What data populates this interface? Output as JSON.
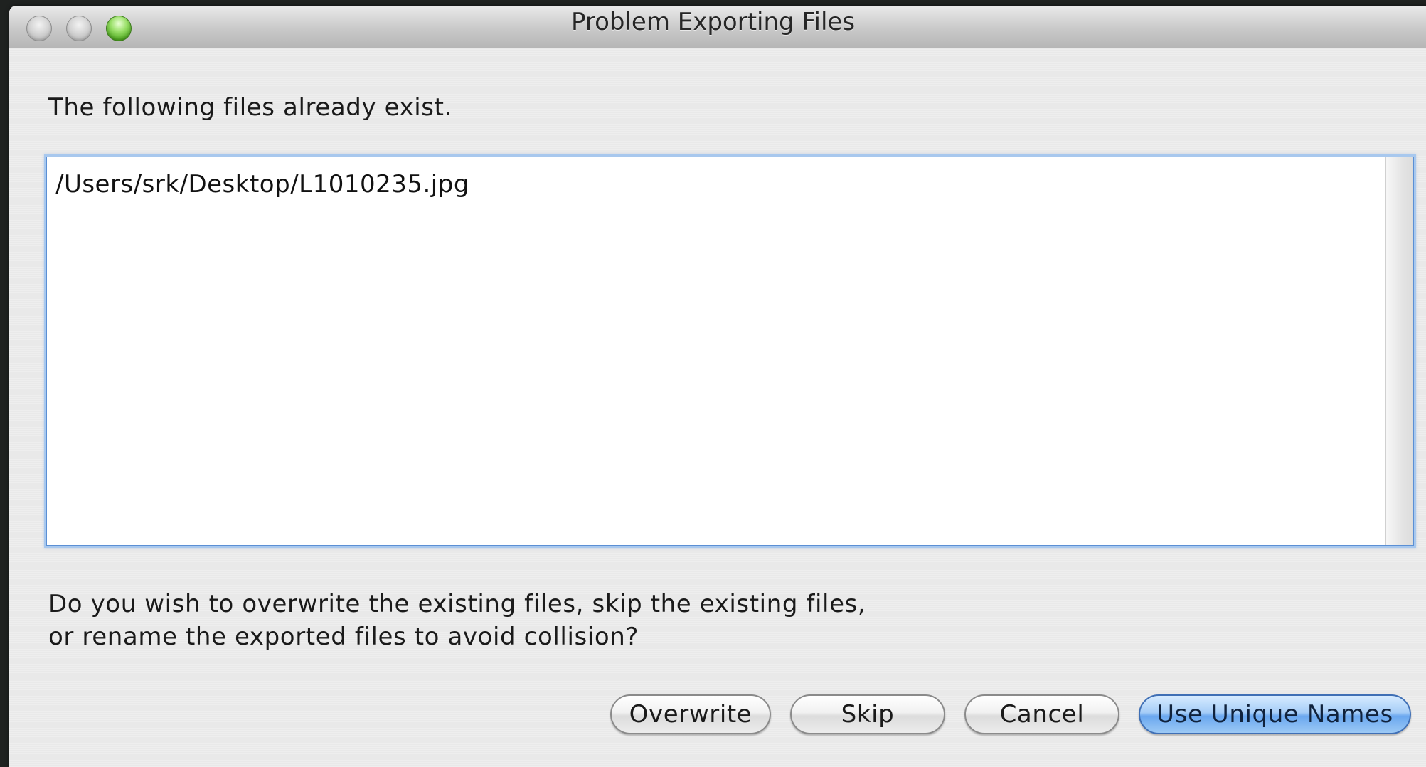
{
  "window": {
    "title": "Problem Exporting Files"
  },
  "dialog": {
    "intro": "The following files already exist.",
    "files_text": "/Users/srk/Desktop/L1010235.jpg",
    "question_line1": "Do you wish to overwrite the existing files, skip the existing files,",
    "question_line2": "or rename the exported files to avoid collision?"
  },
  "buttons": {
    "overwrite": "Overwrite",
    "skip": "Skip",
    "cancel": "Cancel",
    "use_unique_names": "Use Unique Names"
  },
  "colors": {
    "primary_button": "#6aa7ef",
    "focus_ring": "#a8c8ee",
    "zoom_button": "#4aa51b"
  }
}
